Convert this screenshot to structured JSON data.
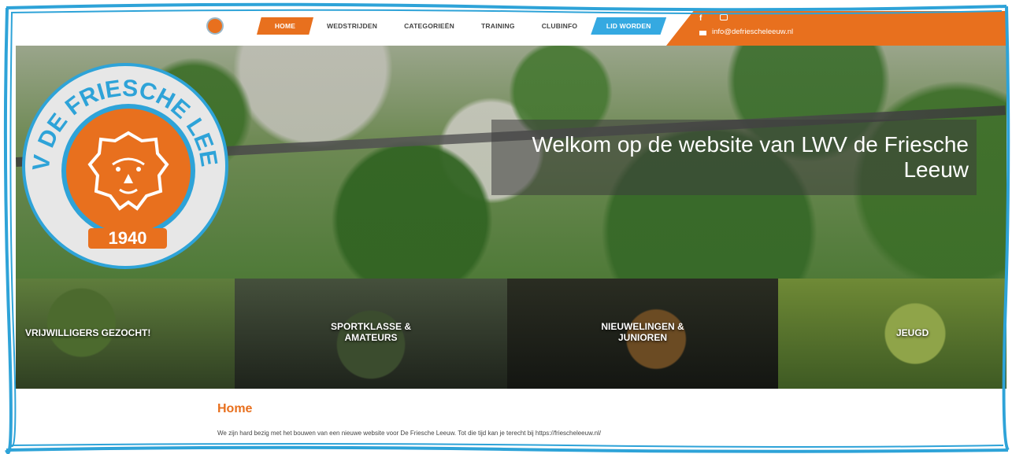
{
  "colors": {
    "brand_orange": "#e8701e",
    "brand_blue": "#35a9e1",
    "frame_blue": "#2ea3d8"
  },
  "nav": {
    "items": [
      {
        "label": "HOME"
      },
      {
        "label": "WEDSTRIJDEN"
      },
      {
        "label": "CATEGORIEËN"
      },
      {
        "label": "TRAINING"
      },
      {
        "label": "CLUBINFO"
      },
      {
        "label": "LID WORDEN"
      }
    ]
  },
  "contact": {
    "email": "info@defriescheleeuw.nl",
    "icons": [
      "facebook-icon",
      "instagram-icon",
      "mail-icon"
    ]
  },
  "logo": {
    "name": "LWV DE FRIESCHE LEEUW",
    "year": "1940"
  },
  "hero": {
    "welcome": "Welkom op de website van LWV de Friesche Leeuw"
  },
  "tiles": [
    {
      "label": "VRIJWILLIGERS GEZOCHT!"
    },
    {
      "label": "SPORTKLASSE & AMATEURS"
    },
    {
      "label": "NIEUWELINGEN & JUNIOREN"
    },
    {
      "label": "JEUGD"
    }
  ],
  "main": {
    "title": "Home",
    "intro": "We zijn hard bezig met het bouwen van een nieuwe website voor De Friesche Leeuw. Tot die tijd kan je terecht bij https://friescheleeuw.nl/"
  }
}
